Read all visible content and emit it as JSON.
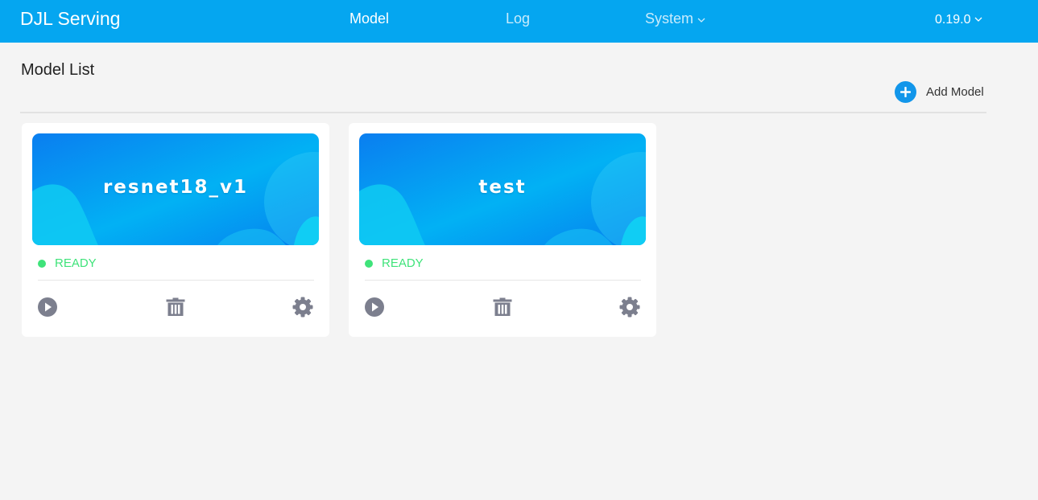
{
  "header": {
    "brand": "DJL Serving",
    "nav": [
      {
        "label": "Model",
        "active": true
      },
      {
        "label": "Log",
        "active": false
      },
      {
        "label": "System",
        "active": false,
        "has_dropdown": true
      }
    ],
    "version": "0.19.0"
  },
  "main": {
    "title": "Model List",
    "add_button_label": "Add Model",
    "models": [
      {
        "name": "resnet18_v1",
        "status": "READY"
      },
      {
        "name": "test",
        "status": "READY"
      }
    ]
  },
  "icons": {
    "add": "plus-circle-icon",
    "run": "play-circle-icon",
    "delete": "trash-icon",
    "settings": "gear-icon",
    "dropdown": "chevron-down-icon"
  },
  "colors": {
    "header_bg": "#05a6f0",
    "accent": "#1296ea",
    "status_ready": "#3fe37a",
    "icon_gray": "#7c7f8e",
    "page_bg": "#f4f4f4"
  }
}
